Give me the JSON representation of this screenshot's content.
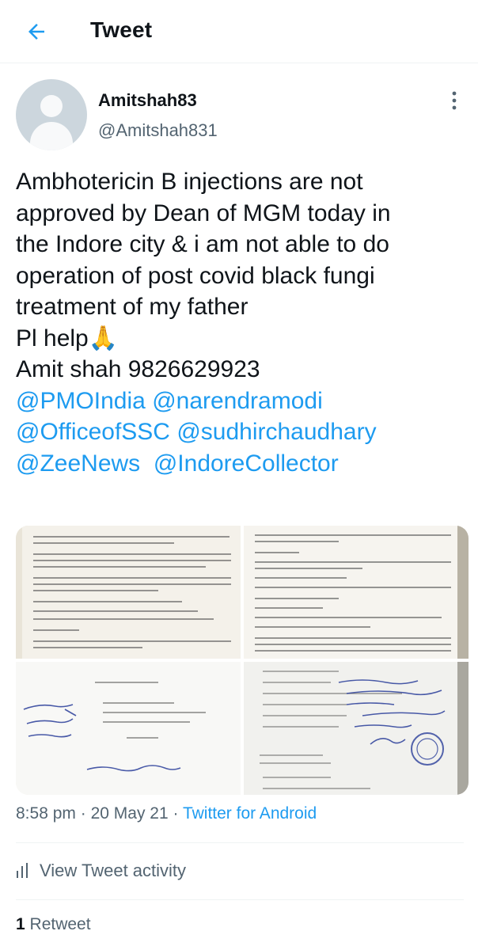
{
  "header": {
    "title": "Tweet",
    "back_icon": "arrow-left-icon"
  },
  "accent_color": "#1d9bf0",
  "author": {
    "display_name": "Amitshah83",
    "handle": "@Amitshah831"
  },
  "tweet": {
    "lines": [
      "Ambhotericin B injections are not",
      "approved by Dean of MGM today in",
      "the Indore city & i am not able to do",
      "operation of post covid black fungi",
      "treatment of my father",
      "Pl help🙏",
      "Amit shah 9826629923"
    ],
    "mentions": [
      [
        "@PMOIndia",
        "@narendramodi"
      ],
      [
        "@OfficeofSSC",
        "@sudhirchaudhary"
      ],
      [
        "@ZeeNews",
        "@IndoreCollector"
      ]
    ]
  },
  "media": {
    "count": 4,
    "items": [
      {
        "name": "mri-report-page-1",
        "icon": "photo-icon"
      },
      {
        "name": "ct-report-page",
        "icon": "photo-icon"
      },
      {
        "name": "prescription-page",
        "icon": "photo-icon"
      },
      {
        "name": "request-form-page",
        "icon": "photo-icon"
      }
    ]
  },
  "meta": {
    "time": "8:58 pm",
    "date": "20 May 21",
    "separator": "·",
    "source": "Twitter for Android"
  },
  "activity": {
    "label": "View Tweet activity",
    "icon": "bar-chart-icon"
  },
  "stats": {
    "retweets_count": "1",
    "retweets_label": "Retweet"
  }
}
